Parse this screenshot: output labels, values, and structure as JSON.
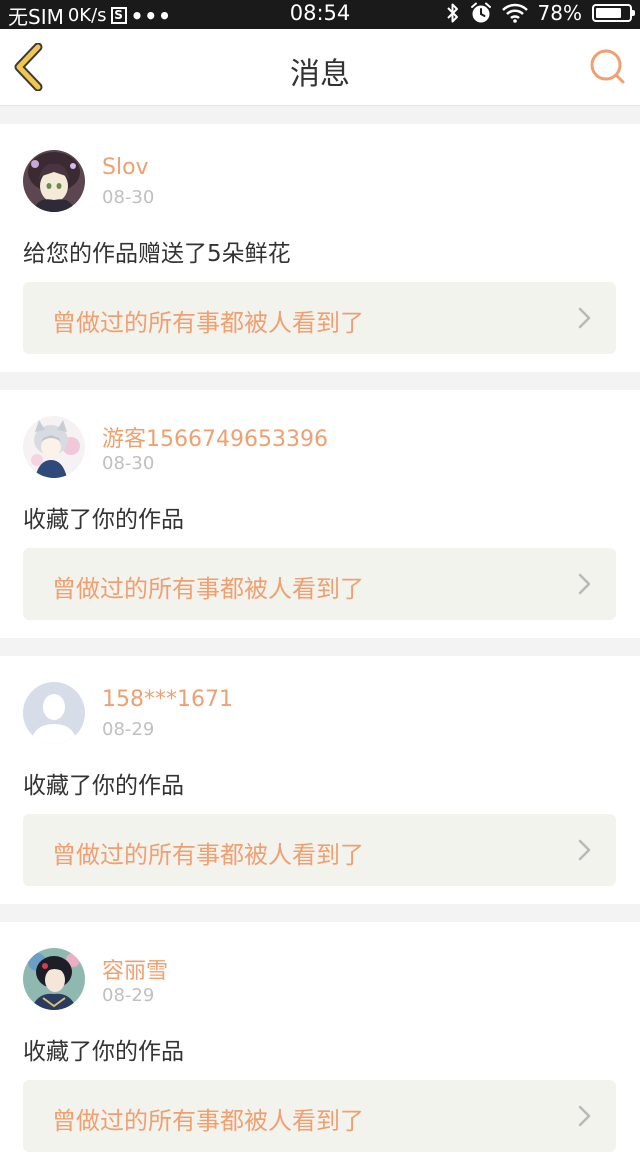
{
  "status_bar": {
    "carrier": "无SIM",
    "speed": "0K/s",
    "sim_icon_text": "S",
    "dots": "•••",
    "time": "08:54",
    "battery": "78%",
    "battery_level": 0.78,
    "icons": [
      "bluetooth-icon",
      "alarm-icon",
      "wifi-icon",
      "battery-icon"
    ]
  },
  "header": {
    "title": "消息",
    "back_icon": "chevron-left-icon",
    "search_icon": "search-icon",
    "accent_color": "#f0a070",
    "back_color": "#f2c74e"
  },
  "messages": [
    {
      "username": "Slov",
      "date": "08-30",
      "text": "给您的作品赠送了5朵鲜花",
      "work_title": "曾做过的所有事都被人看到了",
      "avatar": "anime-girl-avatar"
    },
    {
      "username": "游客1566749653396",
      "date": "08-30",
      "text": "收藏了你的作品",
      "work_title": "曾做过的所有事都被人看到了",
      "avatar": "anime-boy-avatar"
    },
    {
      "username": "158***1671",
      "date": "08-29",
      "text": "收藏了你的作品",
      "work_title": "曾做过的所有事都被人看到了",
      "avatar": "default-user-avatar"
    },
    {
      "username": "容丽雪",
      "date": "08-29",
      "text": "收藏了你的作品",
      "work_title": "曾做过的所有事都被人看到了",
      "avatar": "anime-character-avatar"
    }
  ]
}
